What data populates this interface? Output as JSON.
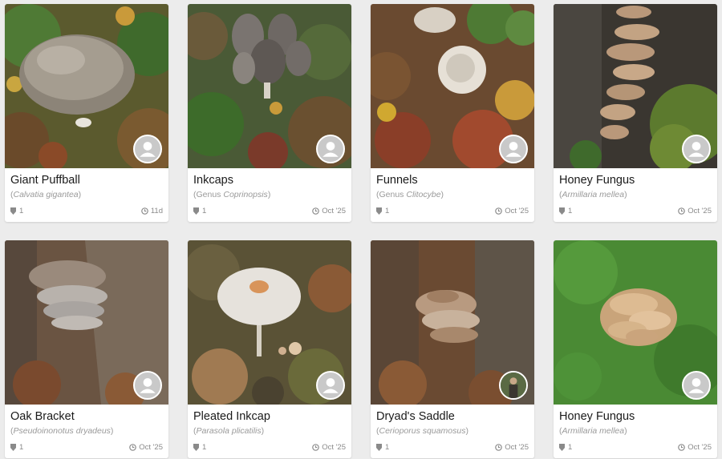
{
  "cards": [
    {
      "name": "Giant Puffball",
      "sci_prefix": "",
      "sci": "Calvatia gigantea",
      "count": "1",
      "time": "11d",
      "avatar": "user-placeholder"
    },
    {
      "name": "Inkcaps",
      "sci_prefix": "Genus ",
      "sci": "Coprinopsis",
      "count": "1",
      "time": "Oct '25",
      "avatar": "user-placeholder"
    },
    {
      "name": "Funnels",
      "sci_prefix": "Genus ",
      "sci": "Clitocybe",
      "count": "1",
      "time": "Oct '25",
      "avatar": "user-placeholder"
    },
    {
      "name": "Honey Fungus",
      "sci_prefix": "",
      "sci": "Armillaria mellea",
      "count": "1",
      "time": "Oct '25",
      "avatar": "user-placeholder"
    },
    {
      "name": "Oak Bracket",
      "sci_prefix": "",
      "sci": "Pseudoinonotus dryadeus",
      "count": "1",
      "time": "Oct '25",
      "avatar": "user-placeholder"
    },
    {
      "name": "Pleated Inkcap",
      "sci_prefix": "",
      "sci": "Parasola plicatilis",
      "count": "1",
      "time": "Oct '25",
      "avatar": "user-placeholder"
    },
    {
      "name": "Dryad's Saddle",
      "sci_prefix": "",
      "sci": "Cerioporus squamosus",
      "count": "1",
      "time": "Oct '25",
      "avatar": "user-photo"
    },
    {
      "name": "Honey Fungus",
      "sci_prefix": "",
      "sci": "Armillaria mellea",
      "count": "1",
      "time": "Oct '25",
      "avatar": "user-placeholder"
    }
  ],
  "icons": {
    "count": "shield-icon",
    "time": "clock-icon"
  },
  "colors": {
    "card_bg": "#ffffff",
    "page_bg": "#ececec",
    "avatar_bg": "#c9c9c9",
    "text": "#1a1a1a",
    "muted": "#9a9a9a"
  }
}
